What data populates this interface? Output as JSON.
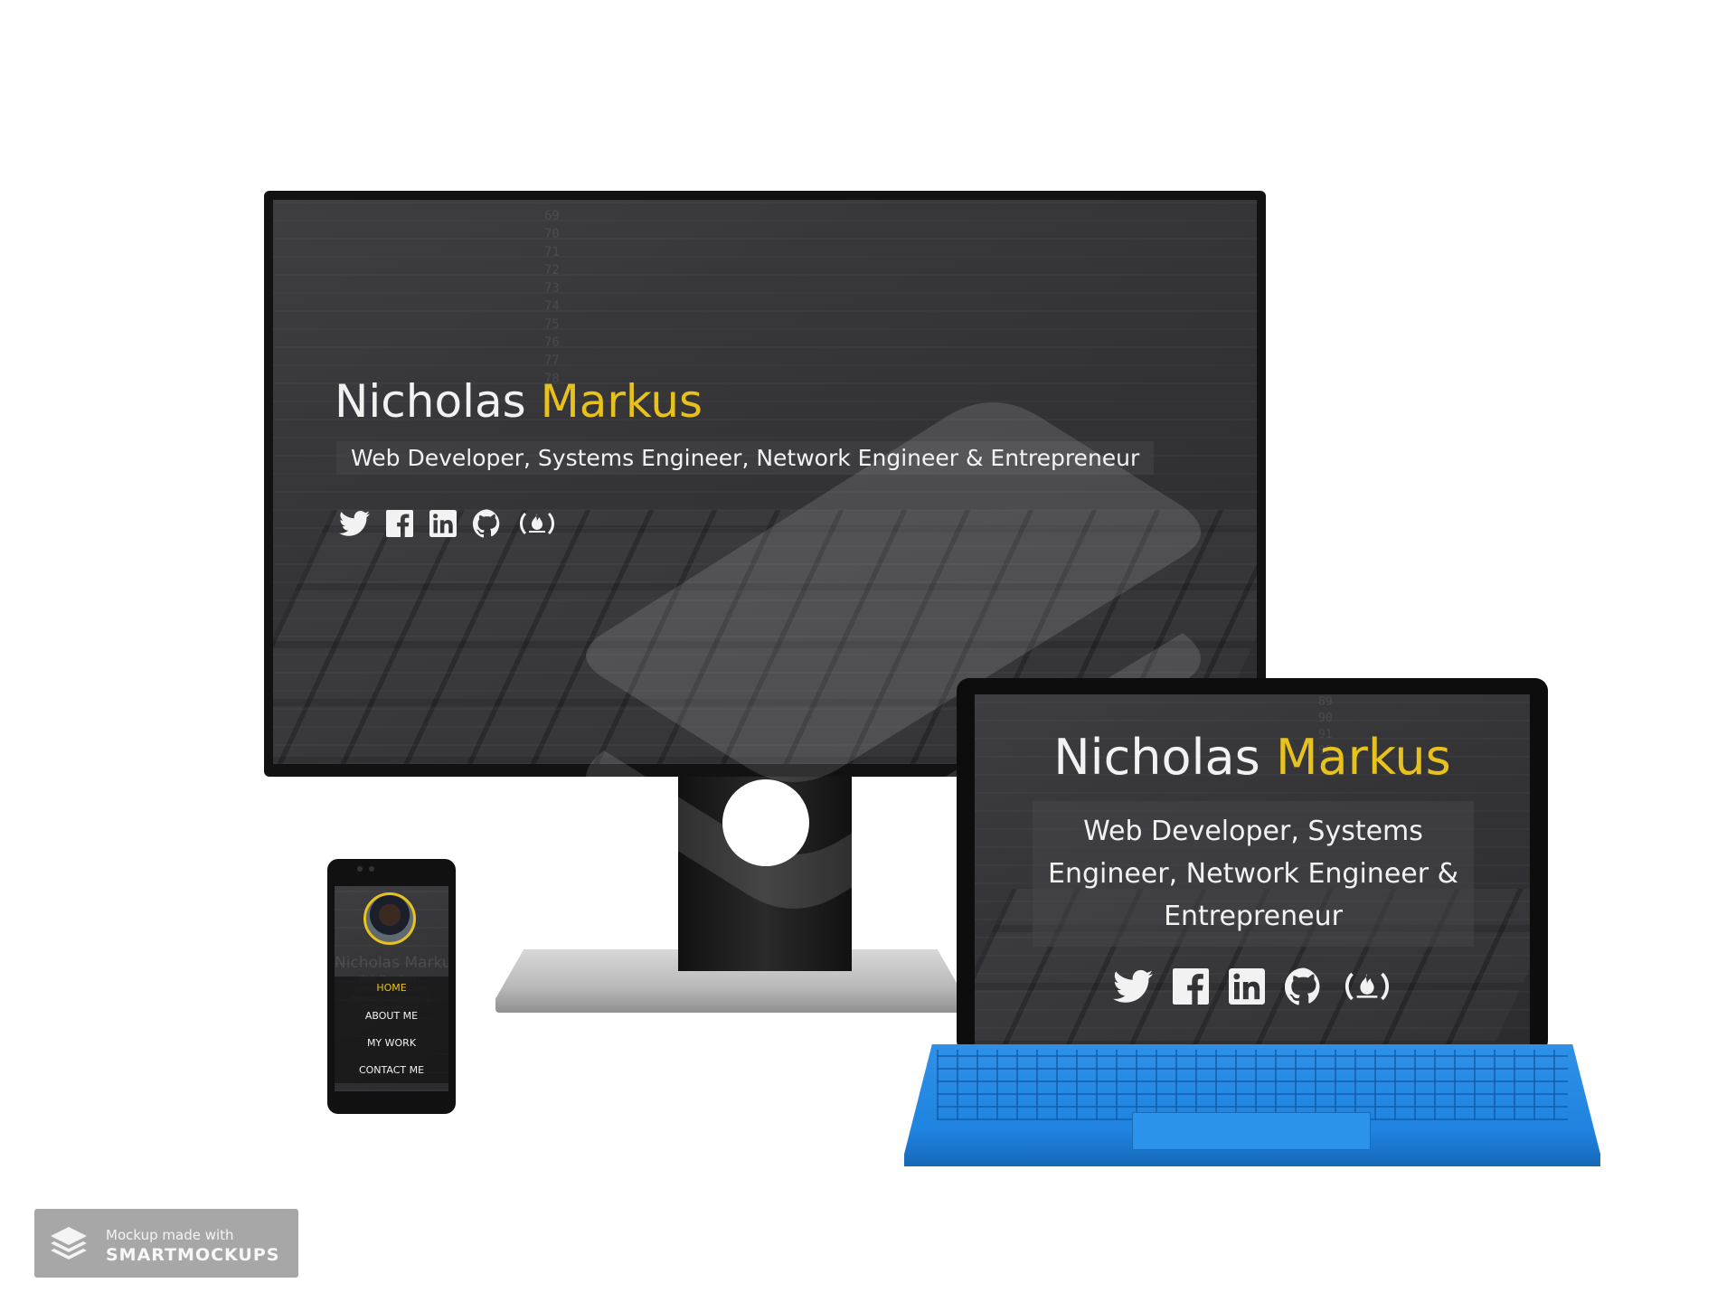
{
  "site": {
    "first_name": "Nicholas",
    "last_name": "Markus",
    "tagline": "Web Developer, Systems Engineer, Network Engineer & Entrepreneur",
    "social": [
      "twitter-icon",
      "facebook-icon",
      "linkedin-icon",
      "github-icon",
      "freecodecamp-icon"
    ],
    "accent_color": "#e8c21c"
  },
  "phone_menu": {
    "items": [
      "HOME",
      "ABOUT ME",
      "MY WORK",
      "CONTACT ME"
    ],
    "active": "HOME"
  },
  "badge": {
    "line1": "Mockup made with",
    "line2": "SMARTMOCKUPS"
  }
}
